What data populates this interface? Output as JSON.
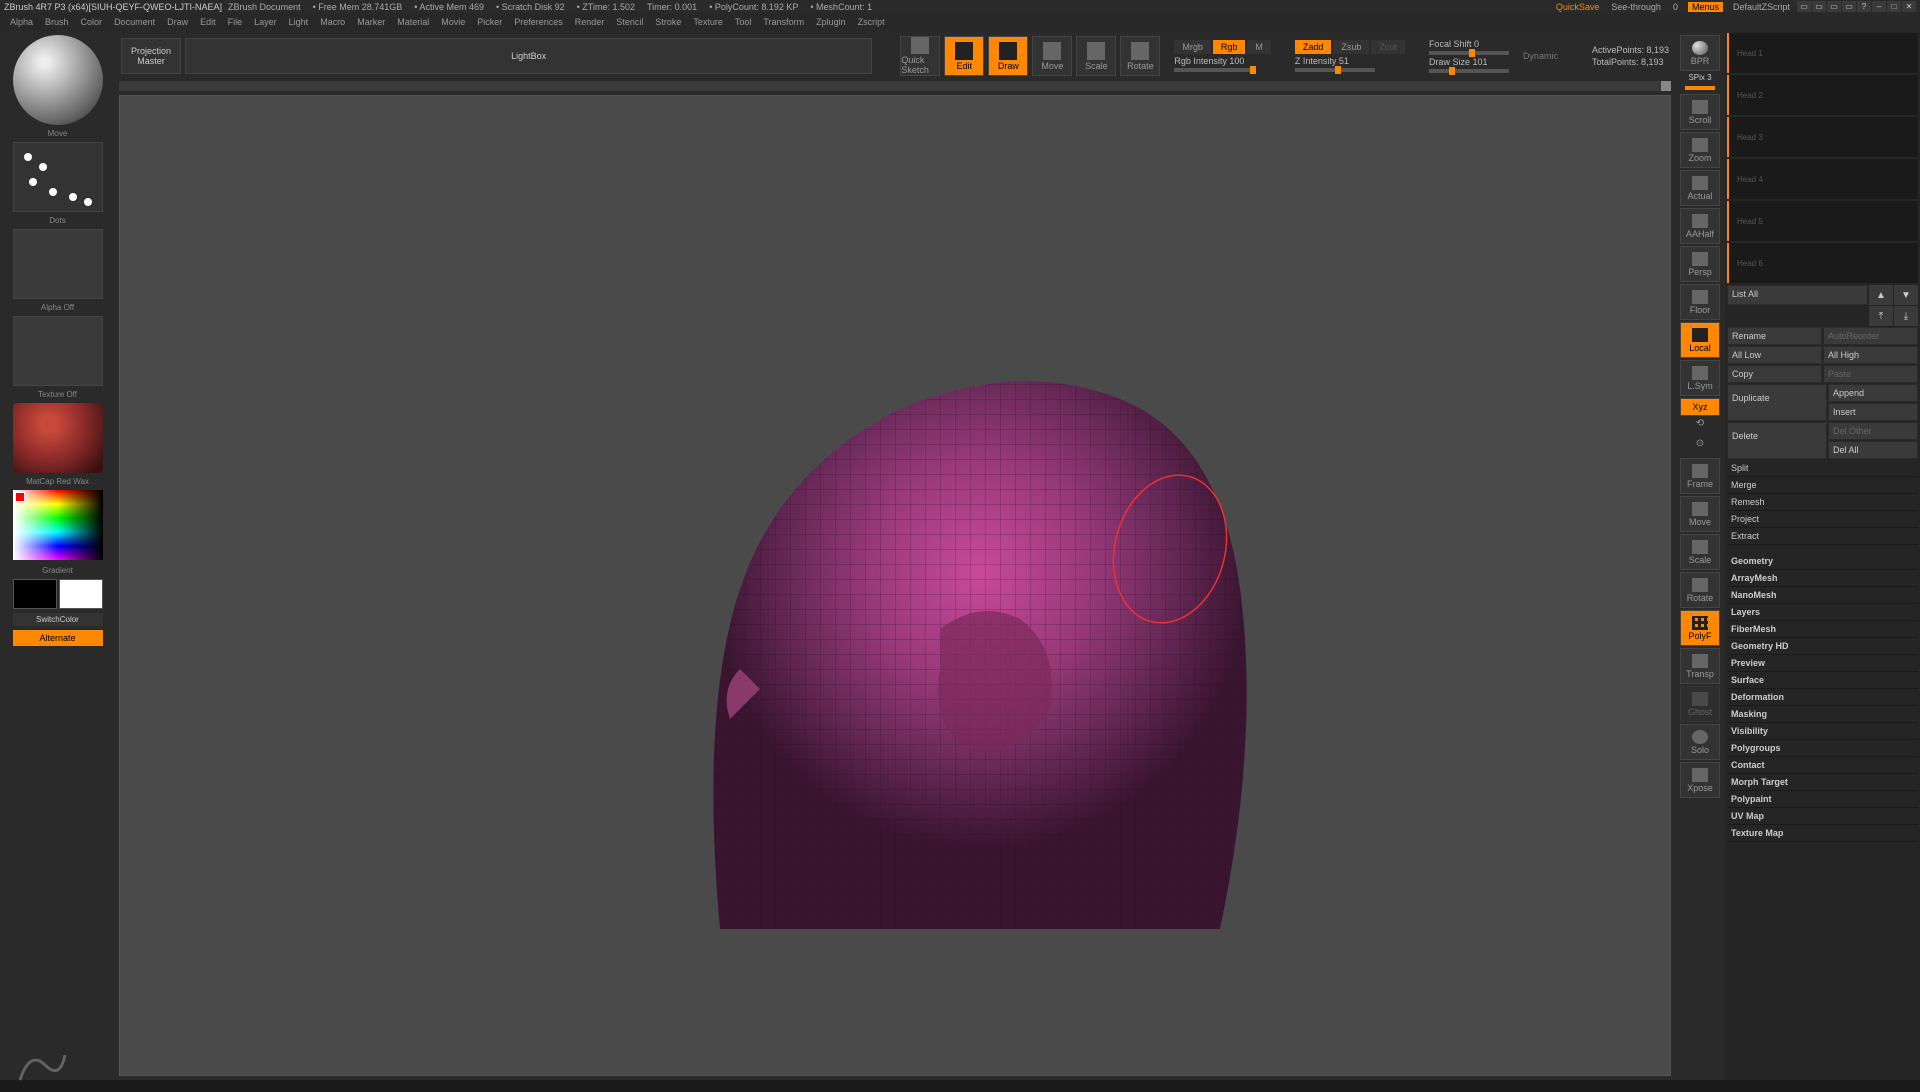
{
  "titlebar": {
    "app": "ZBrush 4R7 P3 (x64)[SIUH-QEYF-QWEO-LJTI-NAEA]",
    "doc": "ZBrush Document",
    "freemem": "• Free Mem 28.741GB",
    "activemem": "• Active Mem 469",
    "scratch": "• Scratch Disk 92",
    "ztime": "• ZTime: 1.502",
    "timer": "Timer: 0.001",
    "polycount": "• PolyCount: 8.192 KP",
    "meshcount": "• MeshCount: 1",
    "quicksave": "QuickSave",
    "seethrough": "See-through",
    "seethrough_val": "0",
    "menus": "Menus",
    "defaultscript": "DefaultZScript"
  },
  "menubar": [
    "Alpha",
    "Brush",
    "Color",
    "Document",
    "Draw",
    "Edit",
    "File",
    "Layer",
    "Light",
    "Macro",
    "Marker",
    "Material",
    "Movie",
    "Picker",
    "Preferences",
    "Render",
    "Stencil",
    "Stroke",
    "Texture",
    "Tool",
    "Transform",
    "Zplugin",
    "Zscript"
  ],
  "left": {
    "projection": "Projection",
    "master": "Master",
    "lightbox": "LightBox",
    "brush_label": "Move",
    "stroke_label": "Dots",
    "alpha_label": "Alpha Off",
    "texture_label": "Texture Off",
    "material_label": "MatCap Red Wax",
    "gradient": "Gradient",
    "switchcolor": "SwitchColor",
    "alternate": "Alternate"
  },
  "toolbar": {
    "quicksketch": "Quick Sketch",
    "edit": "Edit",
    "draw": "Draw",
    "move": "Move",
    "scale": "Scale",
    "rotate": "Rotate",
    "mrgb": "Mrgb",
    "rgb": "Rgb",
    "m": "M",
    "rgb_intensity": "Rgb Intensity 100",
    "zadd": "Zadd",
    "zsub": "Zsub",
    "zcut": "Zcut",
    "z_intensity": "Z Intensity 51",
    "focal": "Focal Shift 0",
    "drawsize": "Draw Size 101",
    "dynamic": "Dynamic",
    "activepoints": "ActivePoints: 8,193",
    "totalpoints": "TotalPoints: 8,193"
  },
  "right_tools": {
    "bpr": "BPR",
    "spix": "SPix 3",
    "scroll": "Scroll",
    "zoom": "Zoom",
    "actual": "Actual",
    "aahalf": "AAHalf",
    "persp": "Persp",
    "floor": "Floor",
    "local": "Local",
    "xyz": "Xyz",
    "lsym": "L.Sym",
    "frame": "Frame",
    "move": "Move",
    "scale": "Scale",
    "rotate": "Rotate",
    "polyf": "PolyF",
    "transp": "Transp",
    "ghost": "Ghost",
    "solo": "Solo",
    "xpose": "Xpose"
  },
  "panel": {
    "subtools": [
      "Head 1",
      "Head 2",
      "Head 3",
      "Head 4",
      "Head 5",
      "Head 6"
    ],
    "listall": "List All",
    "rename": "Rename",
    "autoreorder": "AutoReorder",
    "alllow": "All Low",
    "allhigh": "All High",
    "copy": "Copy",
    "paste": "Paste",
    "duplicate": "Duplicate",
    "append": "Append",
    "insert": "Insert",
    "delete": "Delete",
    "delother": "Del Other",
    "delall": "Del All",
    "split": "Split",
    "merge": "Merge",
    "remesh": "Remesh",
    "project": "Project",
    "extract": "Extract",
    "accordion": [
      "Geometry",
      "ArrayMesh",
      "NanoMesh",
      "Layers",
      "FiberMesh",
      "Geometry HD",
      "Preview",
      "Surface",
      "Deformation",
      "Masking",
      "Visibility",
      "Polygroups",
      "Contact",
      "Morph Target",
      "Polypaint",
      "UV Map",
      "Texture Map"
    ]
  }
}
